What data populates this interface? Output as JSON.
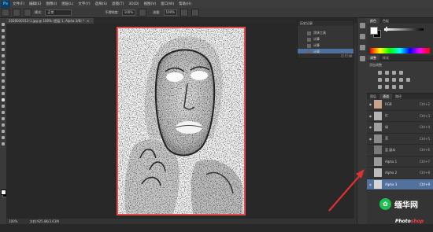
{
  "app": {
    "logo": "Ps"
  },
  "menu": [
    "文件(F)",
    "编辑(E)",
    "图像(I)",
    "图层(L)",
    "文字(Y)",
    "选择(S)",
    "滤镜(T)",
    "3D(D)",
    "视图(V)",
    "窗口(W)",
    "帮助(H)"
  ],
  "options": {
    "mode_label": "模式:",
    "mode_value": "正常",
    "opacity_label": "不透明度:",
    "opacity_value": "100%",
    "flow_label": "流量:",
    "flow_value": "100%"
  },
  "document": {
    "tab_title": "2020030313-1.jpg @ 100% (图层 1, Alpha 3/8) *",
    "close": "×"
  },
  "status": {
    "zoom": "100%",
    "doc": "文档:925.8K/3.61M"
  },
  "history_panel": {
    "title": "历史记录",
    "items": [
      "涂抹工具",
      "计算",
      "计算",
      "计算"
    ],
    "selected_index": 3
  },
  "right_panel": {
    "color_tabs": [
      "颜色",
      "色板"
    ],
    "adjust_tabs": [
      "调整",
      "样式"
    ],
    "adjust_label": "添加调整",
    "channel_tabs": [
      "图层",
      "通道",
      "路径"
    ],
    "channels": [
      {
        "name": "RGB",
        "shortcut": "Ctrl+2",
        "visible": true
      },
      {
        "name": "红",
        "shortcut": "Ctrl+3",
        "visible": true
      },
      {
        "name": "绿",
        "shortcut": "Ctrl+4",
        "visible": true
      },
      {
        "name": "蓝",
        "shortcut": "Ctrl+5",
        "visible": true
      },
      {
        "name": "蓝 副本",
        "shortcut": "Ctrl+6",
        "visible": false
      },
      {
        "name": "Alpha 1",
        "shortcut": "Ctrl+7",
        "visible": false
      },
      {
        "name": "Alpha 2",
        "shortcut": "Ctrl+8",
        "visible": false
      },
      {
        "name": "Alpha 3",
        "shortcut": "Ctrl+9",
        "visible": true
      }
    ],
    "selected_channel": 7
  },
  "watermark": {
    "brand": "缅华网",
    "sub_left": "Photo",
    "sub_right": "shop"
  },
  "colors": {
    "accent": "#e04a4a",
    "selection": "#52719d"
  }
}
